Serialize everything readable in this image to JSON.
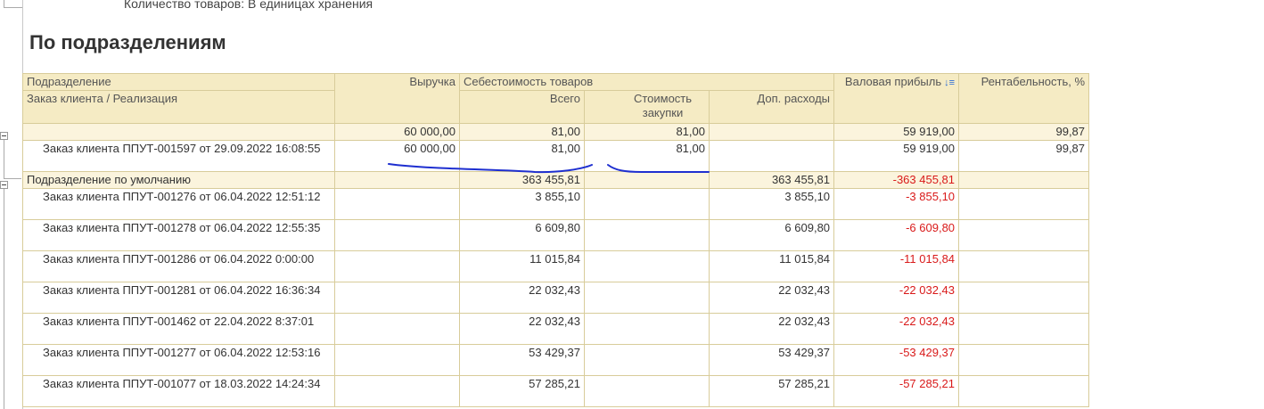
{
  "settings_line": "Количество товаров: В единицах хранения",
  "section_title": "По подразделениям",
  "headers": {
    "division": "Подразделение",
    "order": "Заказ клиента / Реализация",
    "revenue": "Выручка",
    "cost_group": "Себестоимость товаров",
    "total": "Всего",
    "purchase": "Стоимость закупки",
    "extra": "Доп. расходы",
    "gross": "Валовая прибыль",
    "profitability": "Рентабельность, %",
    "sort_icon": "sort-descending-icon"
  },
  "groups": [
    {
      "label": "",
      "revenue": "60 000,00",
      "total": "81,00",
      "purchase": "81,00",
      "extra": "",
      "gross": "59 919,00",
      "profitability": "99,87",
      "rows": [
        {
          "label": "Заказ клиента ППУТ-001597 от 29.09.2022 16:08:55",
          "revenue": "60 000,00",
          "total": "81,00",
          "purchase": "81,00",
          "extra": "",
          "gross": "59 919,00",
          "profitability": "99,87"
        }
      ]
    },
    {
      "label": "Подразделение по умолчанию",
      "revenue": "",
      "total": "363 455,81",
      "purchase": "",
      "extra": "363 455,81",
      "gross": "-363 455,81",
      "profitability": "",
      "rows": [
        {
          "label": "Заказ клиента ППУТ-001276 от 06.04.2022 12:51:12",
          "revenue": "",
          "total": "3 855,10",
          "purchase": "",
          "extra": "3 855,10",
          "gross": "-3 855,10",
          "profitability": ""
        },
        {
          "label": "Заказ клиента ППУТ-001278 от 06.04.2022 12:55:35",
          "revenue": "",
          "total": "6 609,80",
          "purchase": "",
          "extra": "6 609,80",
          "gross": "-6 609,80",
          "profitability": ""
        },
        {
          "label": "Заказ клиента ППУТ-001286 от 06.04.2022 0:00:00",
          "revenue": "",
          "total": "11 015,84",
          "purchase": "",
          "extra": "11 015,84",
          "gross": "-11 015,84",
          "profitability": ""
        },
        {
          "label": "Заказ клиента ППУТ-001281 от 06.04.2022 16:36:34",
          "revenue": "",
          "total": "22 032,43",
          "purchase": "",
          "extra": "22 032,43",
          "gross": "-22 032,43",
          "profitability": ""
        },
        {
          "label": "Заказ клиента ППУТ-001462 от 22.04.2022 8:37:01",
          "revenue": "",
          "total": "22 032,43",
          "purchase": "",
          "extra": "22 032,43",
          "gross": "-22 032,43",
          "profitability": ""
        },
        {
          "label": "Заказ клиента ППУТ-001277 от 06.04.2022 12:53:16",
          "revenue": "",
          "total": "53 429,37",
          "purchase": "",
          "extra": "53 429,37",
          "gross": "-53 429,37",
          "profitability": ""
        },
        {
          "label": "Заказ клиента ППУТ-001077 от 18.03.2022 14:24:34",
          "revenue": "",
          "total": "57 285,21",
          "purchase": "",
          "extra": "57 285,21",
          "gross": "-57 285,21",
          "profitability": ""
        }
      ]
    }
  ],
  "colors": {
    "header_bg": "#f5ebc4",
    "group_bg": "#fbf4dd",
    "grid": "#d8cc9a",
    "negative": "#d91a1a",
    "annotation_ink": "#1e2fd0"
  }
}
